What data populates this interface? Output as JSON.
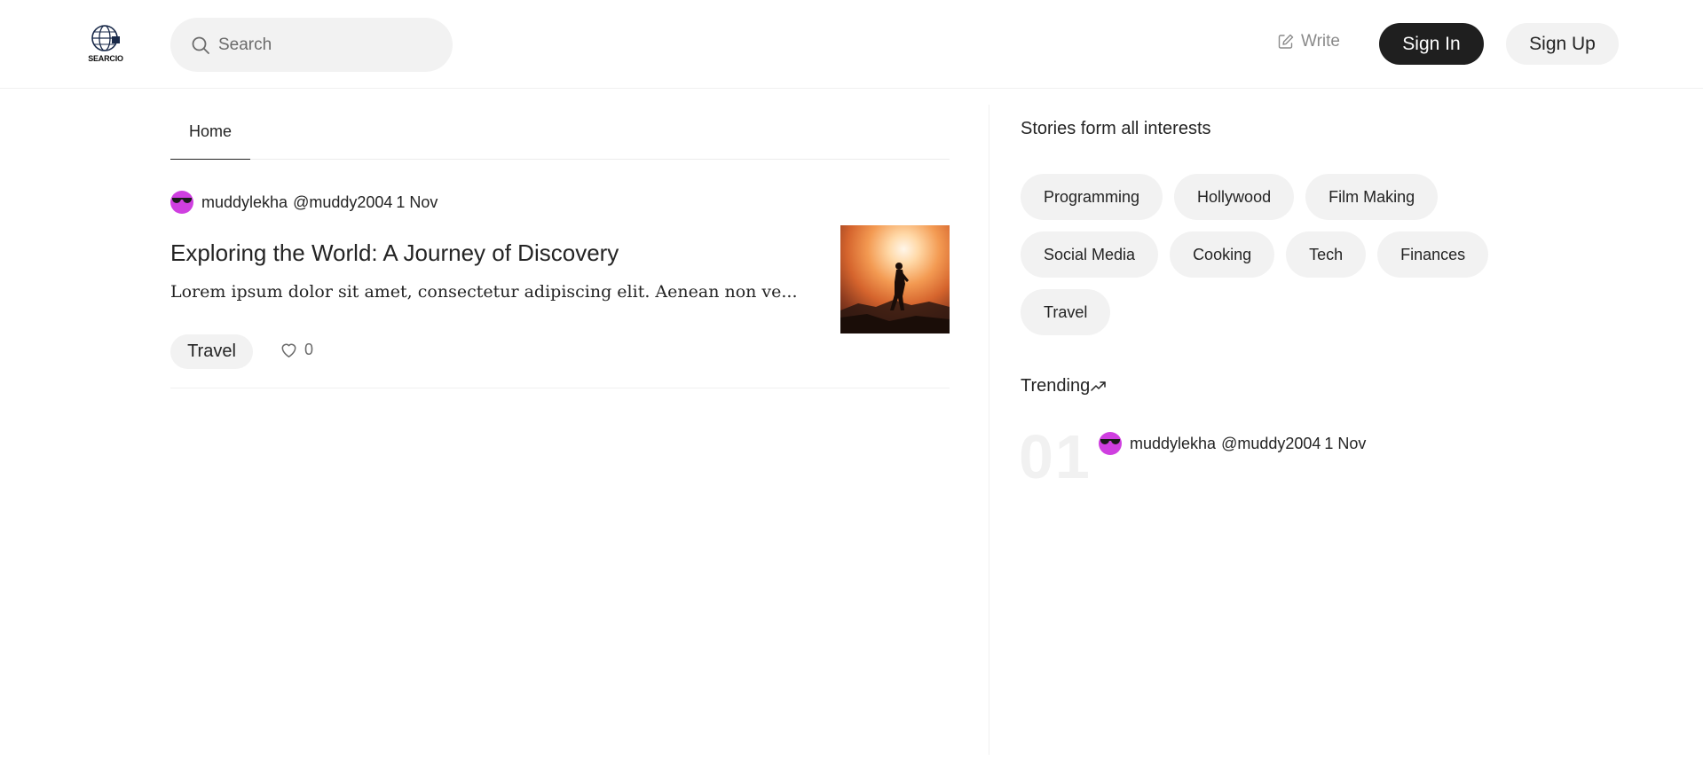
{
  "header": {
    "logo_text": "SEARCIO",
    "search_placeholder": "Search",
    "write_label": "Write",
    "signin_label": "Sign In",
    "signup_label": "Sign Up"
  },
  "tabs": [
    {
      "label": "Home",
      "active": true
    }
  ],
  "post": {
    "author": "muddylekha",
    "handle": "@muddy2004",
    "date": "1 Nov",
    "title": "Exploring the World: A Journey of Discovery",
    "excerpt": "Lorem ipsum dolor sit amet, consectetur adipiscing elit. Aenean non ve...",
    "tag": "Travel",
    "likes": "0",
    "thumbnail": "silhouette-hiker-at-sunset"
  },
  "sidebar": {
    "interests_title": "Stories form all interests",
    "topics": [
      "Programming",
      "Hollywood",
      "Film Making",
      "Social Media",
      "Cooking",
      "Tech",
      "Finances",
      "Travel"
    ],
    "trending_title": "Trending",
    "trending": [
      {
        "rank": "01",
        "author": "muddylekha",
        "handle": "@muddy2004",
        "date": "1 Nov"
      }
    ]
  },
  "icons": {
    "search": "search-icon",
    "write": "edit-icon",
    "like": "heart-icon",
    "trending": "trending-up-icon",
    "avatar": "sunglasses-avatar"
  },
  "colors": {
    "primary_button": "#1f1f1f",
    "chip_background": "#f2f2f2",
    "avatar": "#cf3fe0"
  }
}
